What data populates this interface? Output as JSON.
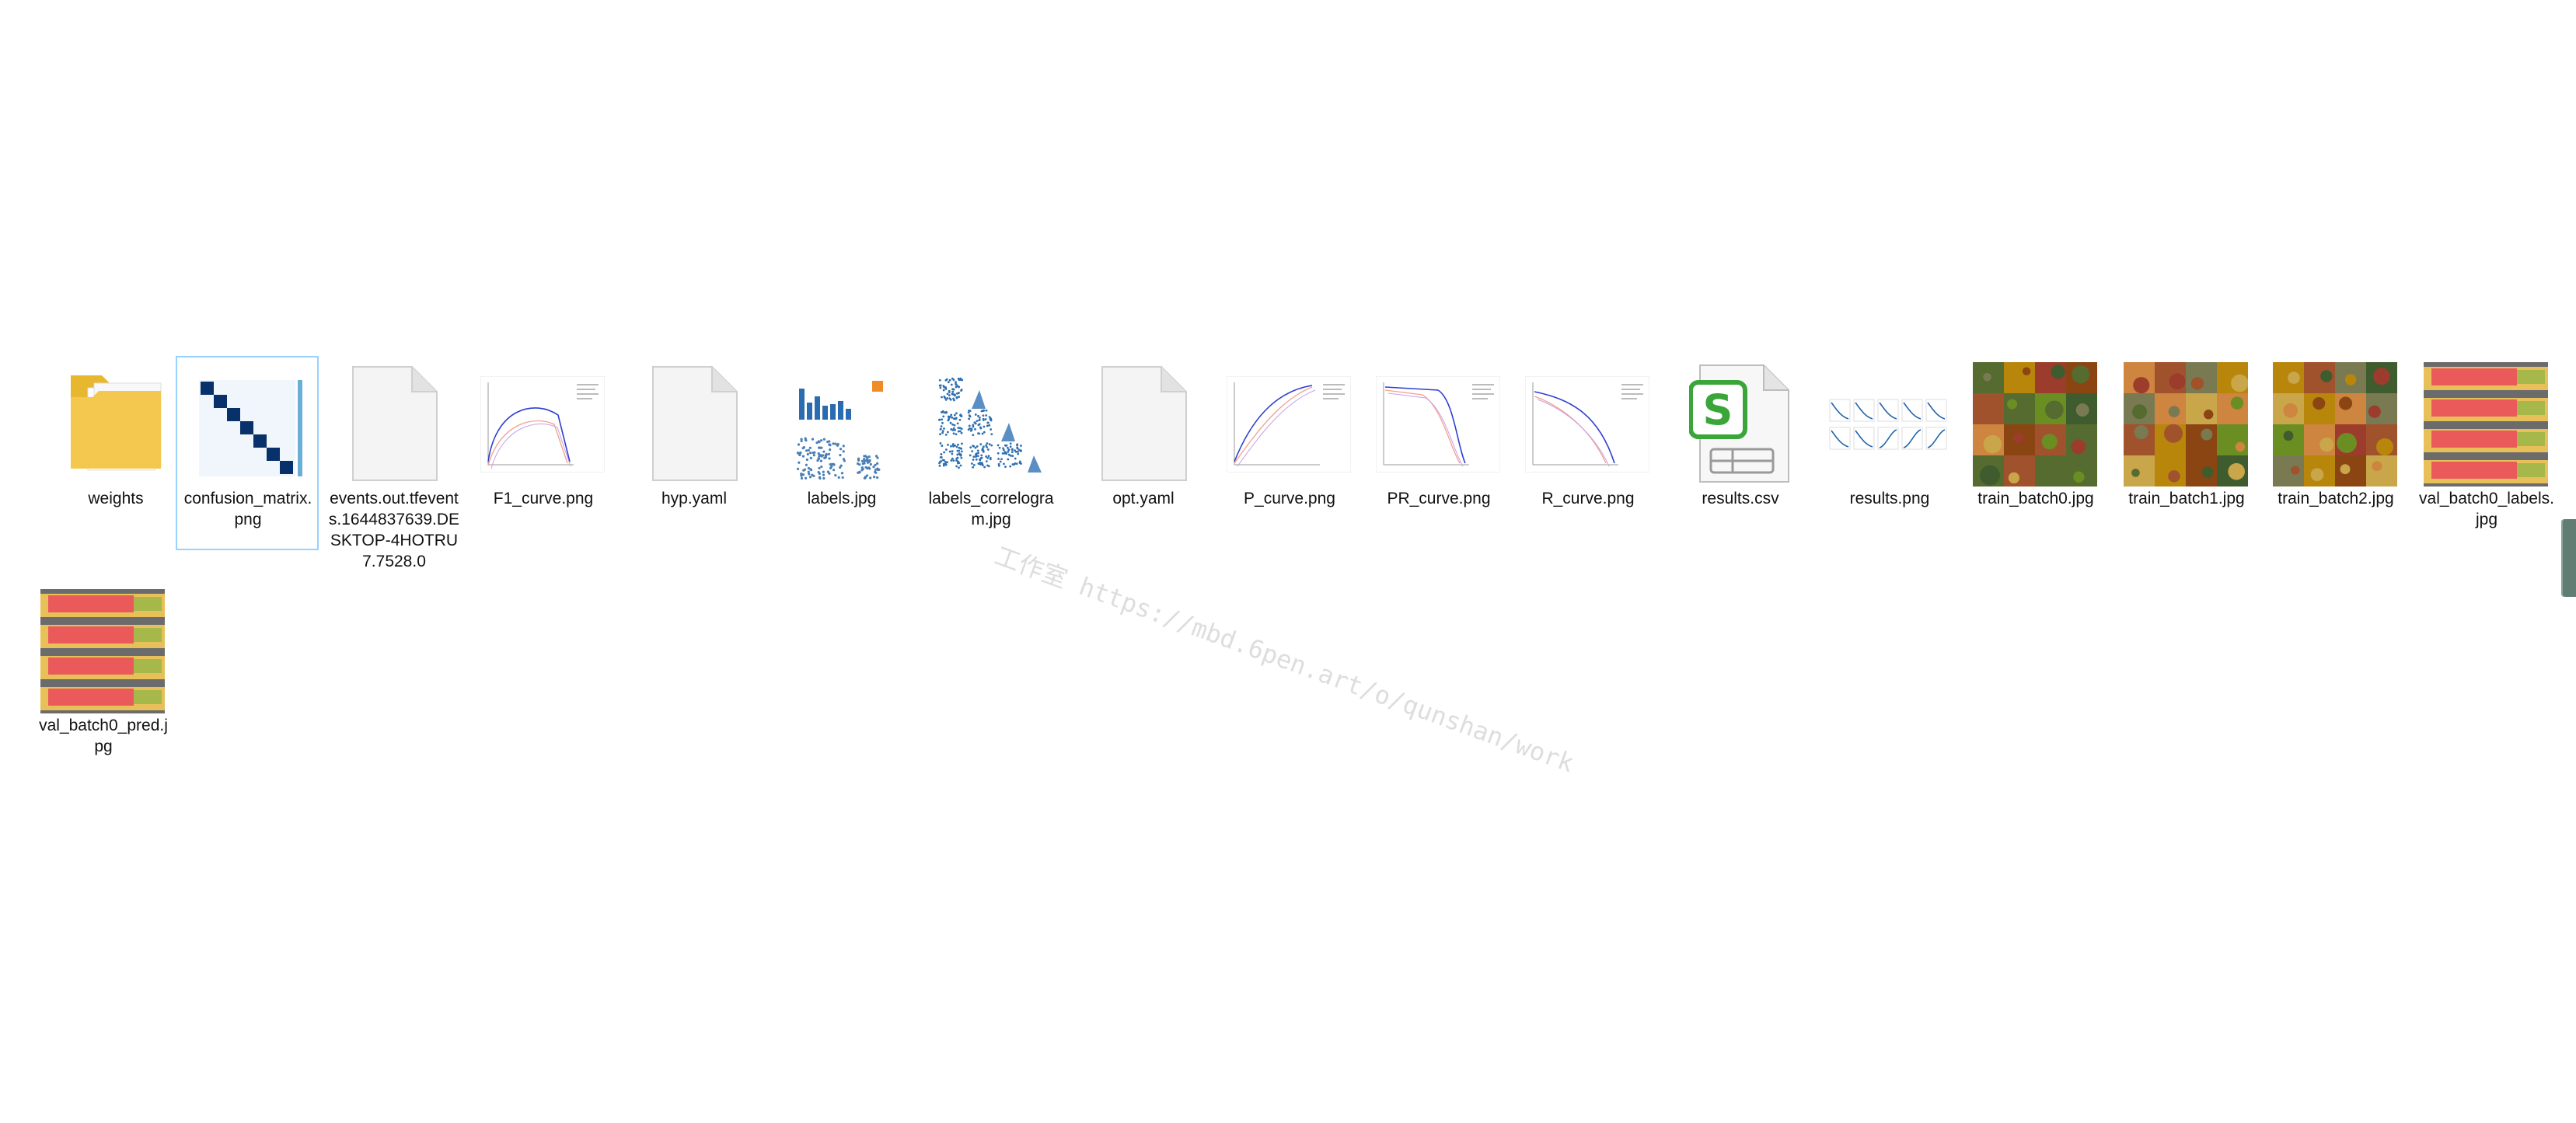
{
  "window": {
    "view": "large-icons",
    "background": "#ffffff"
  },
  "files": [
    {
      "name": "weights",
      "icon": "folder-icon",
      "selected": false
    },
    {
      "name": "confusion_matrix.png",
      "icon": "confusion-matrix-thumbnail",
      "selected": true
    },
    {
      "name": "events.out.tfevents.1644837639.DESKTOP-4HOTRU7.7528.0",
      "icon": "blank-file-icon",
      "selected": false
    },
    {
      "name": "F1_curve.png",
      "icon": "f1-curve-thumbnail",
      "selected": false
    },
    {
      "name": "hyp.yaml",
      "icon": "blank-file-icon",
      "selected": false
    },
    {
      "name": "labels.jpg",
      "icon": "labels-thumbnail",
      "selected": false
    },
    {
      "name": "labels_correlogram.jpg",
      "icon": "correlogram-thumbnail",
      "selected": false
    },
    {
      "name": "opt.yaml",
      "icon": "blank-file-icon",
      "selected": false
    },
    {
      "name": "P_curve.png",
      "icon": "p-curve-thumbnail",
      "selected": false
    },
    {
      "name": "PR_curve.png",
      "icon": "pr-curve-thumbnail",
      "selected": false
    },
    {
      "name": "R_curve.png",
      "icon": "r-curve-thumbnail",
      "selected": false
    },
    {
      "name": "results.csv",
      "icon": "spreadsheet-file-icon",
      "selected": false
    },
    {
      "name": "results.png",
      "icon": "results-thumbnail",
      "selected": false
    },
    {
      "name": "train_batch0.jpg",
      "icon": "train-batch-thumbnail",
      "selected": false
    },
    {
      "name": "train_batch1.jpg",
      "icon": "train-batch-thumbnail",
      "selected": false
    },
    {
      "name": "train_batch2.jpg",
      "icon": "train-batch-thumbnail",
      "selected": false
    },
    {
      "name": "val_batch0_labels.jpg",
      "icon": "val-batch-thumbnail",
      "selected": false
    },
    {
      "name": "val_batch0_pred.jpg",
      "icon": "val-batch-thumbnail",
      "selected": false
    }
  ],
  "watermark": {
    "text": "工作室 https://mbd.6pen.art/o/qunshan/work"
  },
  "colors": {
    "selection_border": "#99d1ff",
    "folder": "#f4c84f",
    "spreadsheet_accent": "#3aa63a",
    "plot_blue": "#2166ac"
  }
}
